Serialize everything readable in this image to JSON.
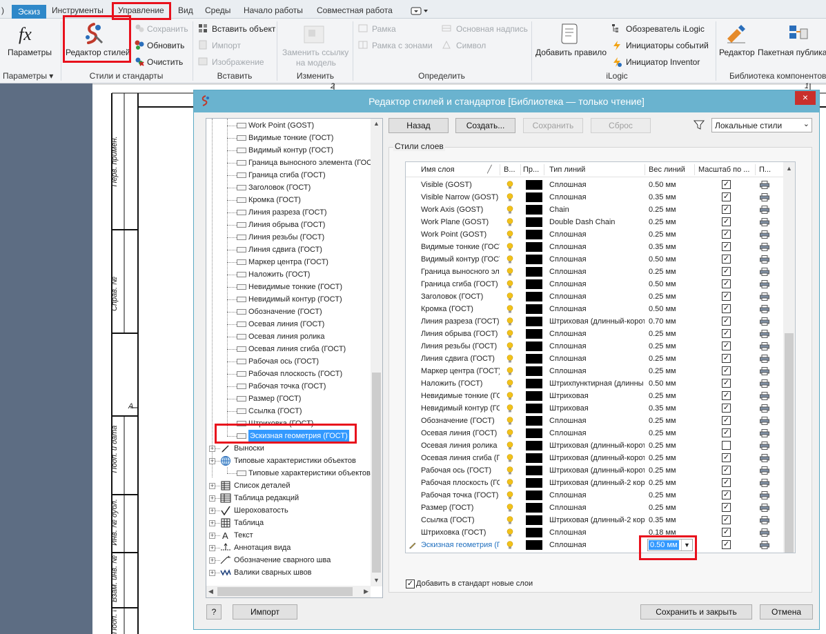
{
  "tabs": [
    {
      "label": ")",
      "key": "edge"
    },
    {
      "label": "Эскиз",
      "key": "sketch"
    },
    {
      "label": "Инструменты",
      "key": "tools"
    },
    {
      "label": "Управление",
      "key": "manage"
    },
    {
      "label": "Вид",
      "key": "view"
    },
    {
      "label": "Среды",
      "key": "env"
    },
    {
      "label": "Начало работы",
      "key": "start"
    },
    {
      "label": "Совместная работа",
      "key": "collab"
    }
  ],
  "ribbon": {
    "params": "Параметры",
    "style_editor": "Редактор стилей",
    "save": "Сохранить",
    "update": "Обновить",
    "purge": "Очистить",
    "insert_object": "Вставить объект",
    "import": "Импорт",
    "image": "Изображение",
    "replace_ref_1": "Заменить ссылку",
    "replace_ref_2": "на модель",
    "frame": "Рамка",
    "frame_zones": "Рамка с зонами",
    "title_block": "Основная надпись",
    "symbol": "Символ",
    "add_rule": "Добавить правило",
    "ilogic_browser": "Обозреватель iLogic",
    "event_triggers": "Инициаторы событий",
    "inventor_triggers": "Инициатор Inventor",
    "editor": "Редактор",
    "batch_publish": "Пакетная публика",
    "groups": {
      "params": "Параметры",
      "styles": "Стили и стандарты",
      "insert": "Вставить",
      "modify": "Изменить",
      "define": "Определить",
      "ilogic": "iLogic",
      "content": "Библиотека компонентов"
    }
  },
  "sheet": {
    "margin_labels": [
      "Перв. примен.",
      "Справ. №",
      "Подп. и дата",
      "Инв. № дубл.",
      "Взам. инв. №",
      "Подп. и дата"
    ],
    "zone_top_left": "2",
    "zone_top_right": "1",
    "zone_side": "A"
  },
  "dialog": {
    "title": "Редактор стилей и стандартов [Библиотека — только чтение]",
    "close_glyph": "×",
    "back": "Назад",
    "create": "Создать...",
    "save": "Сохранить",
    "reset": "Сброс",
    "filter_value": "Локальные стили",
    "section_label": "Стили слоев",
    "add_row": "Добавить",
    "add_new_layers": "Добавить в стандарт новые слои",
    "import": "Импорт",
    "save_close": "Сохранить и закрыть",
    "cancel": "Отмена",
    "help_glyph": "?",
    "selected_weight": "0.50 мм"
  },
  "tree": {
    "layers": [
      "Work Point (GOST)",
      "Видимые тонкие (ГОСТ)",
      "Видимый контур (ГОСТ)",
      "Граница выносного элемента (ГОСТ)",
      "Граница сгиба (ГОСТ)",
      "Заголовок (ГОСТ)",
      "Кромка (ГОСТ)",
      "Линия  разреза (ГОСТ)",
      "Линия обрыва (ГОСТ)",
      "Линия резьбы (ГОСТ)",
      "Линия сдвига (ГОСТ)",
      "Маркер центра (ГОСТ)",
      "Наложить (ГОСТ)",
      "Невидимые тонкие (ГОСТ)",
      "Невидимый контур (ГОСТ)",
      "Обозначение (ГОСТ)",
      "Осевая линия (ГОСТ)",
      "Осевая линия ролика",
      "Осевая линия сгиба (ГОСТ)",
      "Рабочая ось (ГОСТ)",
      "Рабочая плоскость (ГОСТ)",
      "Рабочая точка (ГОСТ)",
      "Размер (ГОСТ)",
      "Ссылка (ГОСТ)",
      "Штриховка (ГОСТ)",
      "Эскизная геометрия (ГОСТ)"
    ],
    "selected": "Эскизная геометрия (ГОСТ)",
    "categories": [
      {
        "label": "Выноски",
        "icon": "leader-icon"
      },
      {
        "label": "Типовые характеристики объектов",
        "icon": "globe-icon"
      },
      {
        "label": "Типовые характеристики объектов",
        "icon": "",
        "child": true
      },
      {
        "label": "Список деталей",
        "icon": "parts-list-icon"
      },
      {
        "label": "Таблица редакций",
        "icon": "revision-table-icon"
      },
      {
        "label": "Шероховатость",
        "icon": "roughness-icon"
      },
      {
        "label": "Таблица",
        "icon": "table-icon"
      },
      {
        "label": "Текст",
        "icon": "text-icon"
      },
      {
        "label": "Аннотация вида",
        "icon": "view-annotation-icon"
      },
      {
        "label": "Обозначение сварного шва",
        "icon": "weld-symbol-icon"
      },
      {
        "label": "Валики сварных швов",
        "icon": "weld-bead-icon"
      }
    ]
  },
  "grid": {
    "headers": [
      "Имя слоя",
      "В...",
      "Пр...",
      "Тип линий",
      "Вес линий",
      "Масштаб по ...",
      "П..."
    ],
    "rows": [
      {
        "name": "Visible (GOST)",
        "type": "Сплошная",
        "weight": "0.50 мм",
        "scale": true
      },
      {
        "name": "Visible Narrow (GOST)",
        "type": "Сплошная",
        "weight": "0.35 мм",
        "scale": true
      },
      {
        "name": "Work Axis (GOST)",
        "type": "Chain",
        "weight": "0.25 мм",
        "scale": true
      },
      {
        "name": "Work Plane (GOST)",
        "type": "Double Dash Chain",
        "weight": "0.25 мм",
        "scale": true
      },
      {
        "name": "Work Point (GOST)",
        "type": "Сплошная",
        "weight": "0.25 мм",
        "scale": true
      },
      {
        "name": "Видимые тонкие (ГОСТ)",
        "type": "Сплошная",
        "weight": "0.35 мм",
        "scale": true
      },
      {
        "name": "Видимый контур (ГОСТ)",
        "type": "Сплошная",
        "weight": "0.50 мм",
        "scale": true
      },
      {
        "name": "Граница выносного эле...",
        "type": "Сплошная",
        "weight": "0.25 мм",
        "scale": true
      },
      {
        "name": "Граница сгиба (ГОСТ)",
        "type": "Сплошная",
        "weight": "0.50 мм",
        "scale": true
      },
      {
        "name": "Заголовок (ГОСТ)",
        "type": "Сплошная",
        "weight": "0.25 мм",
        "scale": true
      },
      {
        "name": "Кромка (ГОСТ)",
        "type": "Сплошная",
        "weight": "0.50 мм",
        "scale": true
      },
      {
        "name": "Линия  разреза (ГОСТ)",
        "type": "Штриховая (длинный-корот",
        "weight": "0.70 мм",
        "scale": true
      },
      {
        "name": "Линия обрыва (ГОСТ)",
        "type": "Сплошная",
        "weight": "0.25 мм",
        "scale": true
      },
      {
        "name": "Линия резьбы (ГОСТ)",
        "type": "Сплошная",
        "weight": "0.25 мм",
        "scale": true
      },
      {
        "name": "Линия сдвига (ГОСТ)",
        "type": "Сплошная",
        "weight": "0.25 мм",
        "scale": true
      },
      {
        "name": "Маркер центра (ГОСТ)",
        "type": "Сплошная",
        "weight": "0.25 мм",
        "scale": true
      },
      {
        "name": "Наложить (ГОСТ)",
        "type": "Штрихпунктирная (длинны",
        "weight": "0.50 мм",
        "scale": true
      },
      {
        "name": "Невидимые тонкие (ГОСТ)",
        "type": "Штриховая",
        "weight": "0.25 мм",
        "scale": true
      },
      {
        "name": "Невидимый контур (ГОСТ)",
        "type": "Штриховая",
        "weight": "0.35 мм",
        "scale": true
      },
      {
        "name": "Обозначение (ГОСТ)",
        "type": "Сплошная",
        "weight": "0.25 мм",
        "scale": true
      },
      {
        "name": "Осевая линия (ГОСТ)",
        "type": "Сплошная",
        "weight": "0.25 мм",
        "scale": true
      },
      {
        "name": "Осевая линия ролика",
        "type": "Штриховая (длинный-корот",
        "weight": "0.25 мм",
        "scale": false
      },
      {
        "name": "Осевая линия сгиба (ГОСТ)",
        "type": "Штриховая (длинный-корот",
        "weight": "0.25 мм",
        "scale": true
      },
      {
        "name": "Рабочая ось (ГОСТ)",
        "type": "Штриховая (длинный-корот",
        "weight": "0.25 мм",
        "scale": true
      },
      {
        "name": "Рабочая плоскость (ГОСТ)",
        "type": "Штриховая (длинный-2 кор",
        "weight": "0.25 мм",
        "scale": true
      },
      {
        "name": "Рабочая точка (ГОСТ)",
        "type": "Сплошная",
        "weight": "0.25 мм",
        "scale": true
      },
      {
        "name": "Размер (ГОСТ)",
        "type": "Сплошная",
        "weight": "0.25 мм",
        "scale": true
      },
      {
        "name": "Ссылка (ГОСТ)",
        "type": "Штриховая (длинный-2 кор",
        "weight": "0.35 мм",
        "scale": true
      },
      {
        "name": "Штриховка (ГОСТ)",
        "type": "Сплошная",
        "weight": "0.18 мм",
        "scale": true
      },
      {
        "name": "Эскизная геометрия (ГОСТ)",
        "type": "Сплошная",
        "weight": "0.50 мм",
        "scale": true,
        "editing": true
      }
    ]
  },
  "colors": {
    "accent": "#1f6fbf",
    "highlight_box": "#e8101c",
    "title_bar": "#6ab3cf",
    "active_tab": "#2e88c9",
    "selection": "#3399ff",
    "bulb": "#f2c21a"
  }
}
